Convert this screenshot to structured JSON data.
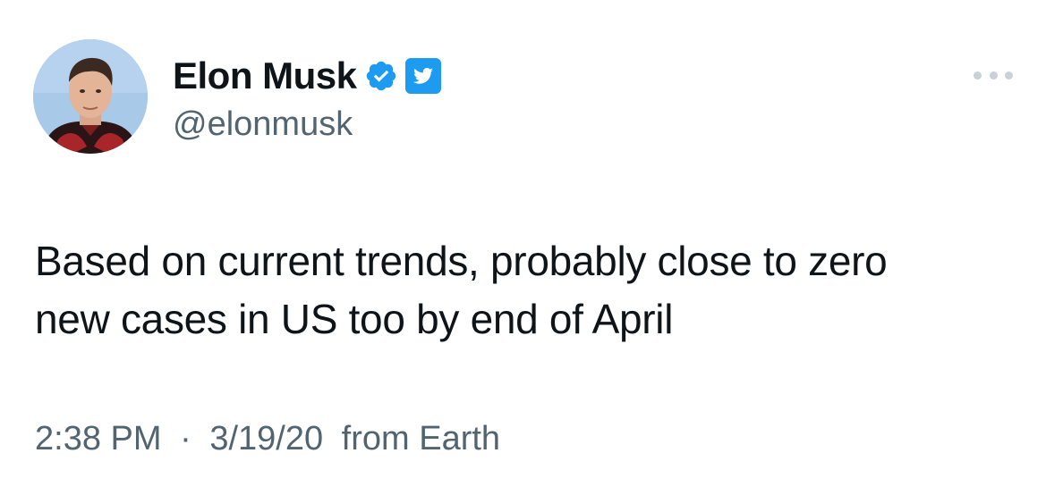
{
  "author": {
    "display_name": "Elon Musk",
    "handle": "@elonmusk",
    "verified": true,
    "verified_icon": "verified-badge-icon",
    "platform_icon": "twitter-bird-icon",
    "avatar": "profile-photo"
  },
  "tweet": {
    "text_line_1": "Based on current trends, probably close to zero",
    "text_line_2": "new cases in US too by end of April"
  },
  "meta": {
    "time": "2:38 PM",
    "separator": "·",
    "date": "3/19/20",
    "source": "from Earth"
  },
  "more_menu_icon": "more-options-icon",
  "colors": {
    "primary_text": "#0f1419",
    "secondary_text": "#536471",
    "accent": "#1d9bf0",
    "more_dots": "#c9d0d6"
  }
}
